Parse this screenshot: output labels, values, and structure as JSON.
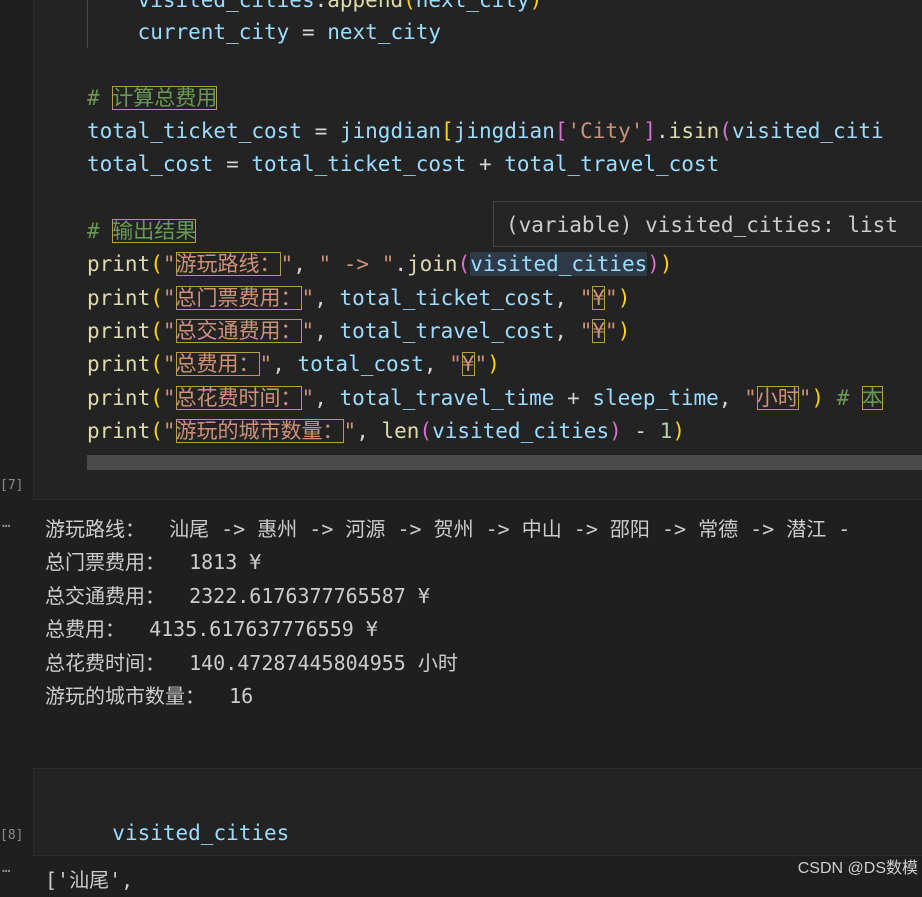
{
  "cell7": {
    "exec_count": "[7]",
    "lines": [
      {
        "id": "l0",
        "parts": [
          [
            "    ",
            "k-op"
          ],
          [
            "visited_cities",
            "k-var"
          ],
          [
            ".",
            "k-op"
          ],
          [
            "append",
            "k-fn"
          ],
          [
            "(",
            "k-br1"
          ],
          [
            "next_city",
            "k-var"
          ],
          [
            ")",
            "k-br1"
          ]
        ]
      },
      {
        "id": "l1",
        "parts": [
          [
            "    ",
            "k-op"
          ],
          [
            "current_city",
            "k-var"
          ],
          [
            " = ",
            "k-op"
          ],
          [
            "next_city",
            "k-var"
          ]
        ]
      },
      {
        "id": "l2",
        "parts": []
      },
      {
        "id": "l3",
        "parts": [
          [
            "# ",
            "k-cmt"
          ],
          [
            "计算总费用",
            "k-cmt hl"
          ]
        ]
      },
      {
        "id": "l4",
        "parts": [
          [
            "total_ticket_cost",
            "k-var"
          ],
          [
            " = ",
            "k-op"
          ],
          [
            "jingdian",
            "k-var"
          ],
          [
            "[",
            "k-br1"
          ],
          [
            "jingdian",
            "k-var"
          ],
          [
            "[",
            "k-br2"
          ],
          [
            "'City'",
            "k-str"
          ],
          [
            "]",
            "k-br2"
          ],
          [
            ".",
            "k-op"
          ],
          [
            "isin",
            "k-fn"
          ],
          [
            "(",
            "k-br2"
          ],
          [
            "visited_citi",
            "k-var"
          ]
        ]
      },
      {
        "id": "l5",
        "parts": [
          [
            "total_cost",
            "k-var"
          ],
          [
            " = ",
            "k-op"
          ],
          [
            "total_ticket_cost",
            "k-var"
          ],
          [
            " + ",
            "k-op"
          ],
          [
            "total_travel_cost",
            "k-var"
          ]
        ]
      },
      {
        "id": "l6",
        "parts": []
      },
      {
        "id": "l7",
        "parts": [
          [
            "# ",
            "k-cmt"
          ],
          [
            "输出结果",
            "k-cmt hl"
          ]
        ]
      },
      {
        "id": "l8",
        "parts": [
          [
            "print",
            "k-fn"
          ],
          [
            "(",
            "k-br1"
          ],
          [
            "\"",
            "k-str"
          ],
          [
            "游玩路线：",
            "k-str hl"
          ],
          [
            "\"",
            "k-str"
          ],
          [
            ", ",
            "k-op"
          ],
          [
            "\" -> \"",
            "k-str"
          ],
          [
            ".",
            "k-op"
          ],
          [
            "join",
            "k-fn"
          ],
          [
            "(",
            "k-br2"
          ],
          [
            "visited_cities",
            "k-var hl-var"
          ],
          [
            ")",
            "k-br2"
          ],
          [
            ")",
            "k-br1"
          ]
        ]
      },
      {
        "id": "l9",
        "parts": [
          [
            "print",
            "k-fn"
          ],
          [
            "(",
            "k-br1"
          ],
          [
            "\"",
            "k-str"
          ],
          [
            "总门票费用：",
            "k-str hl"
          ],
          [
            "\"",
            "k-str"
          ],
          [
            ", ",
            "k-op"
          ],
          [
            "total_ticket_cost",
            "k-var"
          ],
          [
            ", ",
            "k-op"
          ],
          [
            "\"",
            "k-str"
          ],
          [
            "¥",
            "k-str hl"
          ],
          [
            "\"",
            "k-str"
          ],
          [
            ")",
            "k-br1"
          ]
        ]
      },
      {
        "id": "l10",
        "parts": [
          [
            "print",
            "k-fn"
          ],
          [
            "(",
            "k-br1"
          ],
          [
            "\"",
            "k-str"
          ],
          [
            "总交通费用：",
            "k-str hl"
          ],
          [
            "\"",
            "k-str"
          ],
          [
            ", ",
            "k-op"
          ],
          [
            "total_travel_cost",
            "k-var"
          ],
          [
            ", ",
            "k-op"
          ],
          [
            "\"",
            "k-str"
          ],
          [
            "¥",
            "k-str hl"
          ],
          [
            "\"",
            "k-str"
          ],
          [
            ")",
            "k-br1"
          ]
        ]
      },
      {
        "id": "l11",
        "parts": [
          [
            "print",
            "k-fn"
          ],
          [
            "(",
            "k-br1"
          ],
          [
            "\"",
            "k-str"
          ],
          [
            "总费用：",
            "k-str hl"
          ],
          [
            "\"",
            "k-str"
          ],
          [
            ", ",
            "k-op"
          ],
          [
            "total_cost",
            "k-var"
          ],
          [
            ", ",
            "k-op"
          ],
          [
            "\"",
            "k-str"
          ],
          [
            "¥",
            "k-str hl"
          ],
          [
            "\"",
            "k-str"
          ],
          [
            ")",
            "k-br1"
          ]
        ]
      },
      {
        "id": "l12",
        "parts": [
          [
            "print",
            "k-fn"
          ],
          [
            "(",
            "k-br1"
          ],
          [
            "\"",
            "k-str"
          ],
          [
            "总花费时间：",
            "k-str hl"
          ],
          [
            "\"",
            "k-str"
          ],
          [
            ", ",
            "k-op"
          ],
          [
            "total_travel_time",
            "k-var"
          ],
          [
            " + ",
            "k-op"
          ],
          [
            "sleep_time",
            "k-var"
          ],
          [
            ", ",
            "k-op"
          ],
          [
            "\"",
            "k-str"
          ],
          [
            "小时",
            "k-str hl"
          ],
          [
            "\"",
            "k-str"
          ],
          [
            ")",
            "k-br1"
          ],
          [
            " # ",
            "k-cmt"
          ],
          [
            "本",
            "k-cmt hl"
          ]
        ]
      },
      {
        "id": "l13",
        "parts": [
          [
            "print",
            "k-fn"
          ],
          [
            "(",
            "k-br1"
          ],
          [
            "\"",
            "k-str"
          ],
          [
            "游玩的城市数量：",
            "k-str hl"
          ],
          [
            "\"",
            "k-str"
          ],
          [
            ", ",
            "k-op"
          ],
          [
            "len",
            "k-fn"
          ],
          [
            "(",
            "k-br2"
          ],
          [
            "visited_cities",
            "k-var"
          ],
          [
            ")",
            "k-br2"
          ],
          [
            " - ",
            "k-op"
          ],
          [
            "1",
            "k-num"
          ],
          [
            ")",
            "k-br1"
          ]
        ]
      }
    ],
    "tooltip": "(variable) visited_cities: list"
  },
  "output7": {
    "ellipsis": "…",
    "lines": [
      "游玩路线：  汕尾 -> 惠州 -> 河源 -> 贺州 -> 中山 -> 邵阳 -> 常德 -> 潜江 -",
      "总门票费用：  1813 ¥",
      "总交通费用：  2322.6176377765587 ¥",
      "总费用：  4135.617637776559 ¥",
      "总花费时间：  140.47287445804955 小时",
      "游玩的城市数量：  16"
    ]
  },
  "cell8": {
    "exec_count": "[8]",
    "code": "visited_cities"
  },
  "output8": {
    "ellipsis": "…",
    "partial": "['汕尾',"
  },
  "watermark": "CSDN @DS数模"
}
